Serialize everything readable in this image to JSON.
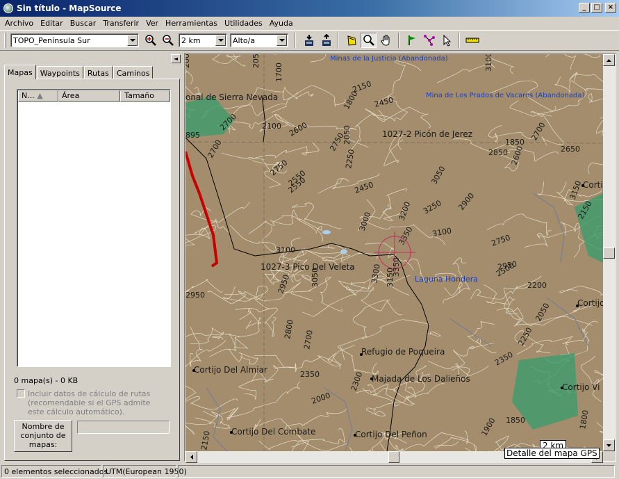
{
  "window": {
    "title": "Sin título - MapSource",
    "min": "_",
    "max": "□",
    "close": "×"
  },
  "menu": [
    "Archivo",
    "Editar",
    "Buscar",
    "Transferir",
    "Ver",
    "Herramientas",
    "Utilidades",
    "Ayuda"
  ],
  "toolbar": {
    "map_product": "TOPO_Península Sur",
    "zoom_value": "2 km",
    "detail_value": "Alto/a"
  },
  "left_panel": {
    "tabs": [
      "Mapas",
      "Waypoints",
      "Rutas",
      "Caminos"
    ],
    "active_tab": "Mapas",
    "columns": [
      "N...",
      "Área",
      "Tamaño"
    ],
    "summary": "0 mapa(s) - 0 KB",
    "routing_checkbox": "Incluir datos de cálculo de rutas (recomendable si el GPS admite este cálculo automático).",
    "routing_lines": [
      "Incluir datos de cálculo de rutas",
      "(recomendable si el GPS admite",
      "este cálculo automático)."
    ],
    "set_name_lines": [
      "Nombre de",
      "conjunto de",
      "mapas:"
    ],
    "set_name_value": ""
  },
  "map": {
    "labels": [
      {
        "t": "Minas de la Justicia (Abandonada)",
        "c": "blue"
      },
      {
        "t": "Mina de Los Prados de Vacares (Abandonada)",
        "c": "blue"
      },
      {
        "t": "onal de Sierra Nevada",
        "c": "dark"
      },
      {
        "t": "1027-2 Picón de Jerez",
        "c": "dark"
      },
      {
        "t": "1027-3 Pico Del Veleta",
        "c": "dark"
      },
      {
        "t": "Laguna Hondera",
        "c": "blue"
      },
      {
        "t": "Refugio de Poqueira",
        "c": "dark"
      },
      {
        "t": "Majada de Los Dalieños",
        "c": "dark"
      },
      {
        "t": "Cortijo Del Almiar",
        "c": "dark"
      },
      {
        "t": "Cortijo Del Combate",
        "c": "dark"
      },
      {
        "t": "Cortijo Del Peñon",
        "c": "dark"
      },
      {
        "t": "Cortijo Vi",
        "c": "dark"
      },
      {
        "t": "Cortijo",
        "c": "dark"
      },
      {
        "t": "Corti",
        "c": "dark"
      }
    ],
    "elevations": [
      "2000",
      "2050",
      "1700",
      "3100",
      "2150",
      "2450",
      "1800",
      "1850",
      "2700",
      "2100",
      "2600",
      "2750",
      "2850",
      "2700",
      "2650",
      "895",
      "2700",
      "2750",
      "2550",
      "2450",
      "2250",
      "2050",
      "3050",
      "2600",
      "2900",
      "2950",
      "3200",
      "3250",
      "3100",
      "2750",
      "3000",
      "3300",
      "3150",
      "2500",
      "2200",
      "2150",
      "3150",
      "2550",
      "2950",
      "3050",
      "3350",
      "3100",
      "3350",
      "2800",
      "2700",
      "2350",
      "2300",
      "2000",
      "2050",
      "2250",
      "2350",
      "1900",
      "1850",
      "1800",
      "2150",
      "2950"
    ],
    "scale_km": "2 km",
    "detail_label": "Detalle del mapa GPS"
  },
  "status": {
    "selected": "0 elementos seleccionados",
    "datum": "UTM(European 1950)"
  },
  "colors": {
    "terrain": "#a38d6d",
    "contour": "#f4edda",
    "water": "#1a40c0",
    "route": "#c80000",
    "green": "#3c9c6c"
  }
}
